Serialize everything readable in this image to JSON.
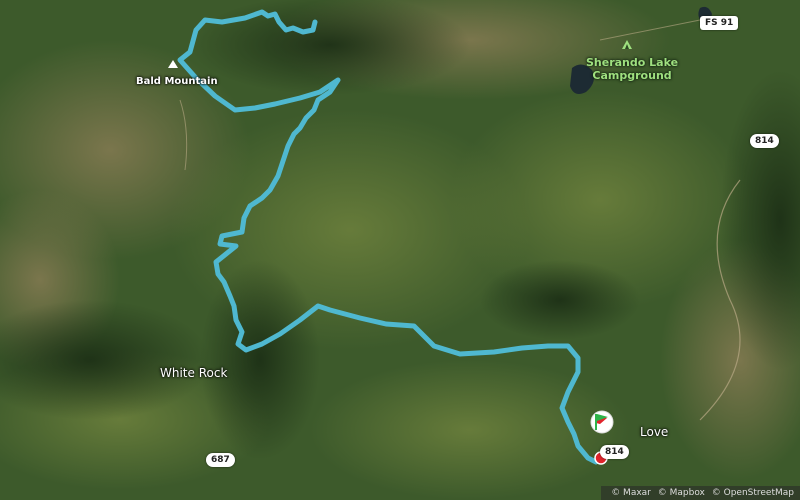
{
  "map": {
    "labels": {
      "bald_mountain": "Bald Mountain",
      "sherando_lake_campground": "Sherando Lake\nCampground",
      "white_rock": "White Rock",
      "love": "Love"
    },
    "road_shields": {
      "fs91": "FS 91",
      "r814_top": "814",
      "r814_bottom": "814",
      "r687": "687"
    },
    "attribution": {
      "maxar": "© Maxar",
      "mapbox": "© Mapbox",
      "osm": "© OpenStreetMap"
    },
    "colors": {
      "route": "#4fb8d0",
      "start_flag_green": "#2fb34a",
      "end_marker_red": "#e0242c",
      "forest": "#3f5f2d"
    },
    "icons": {
      "peak": "peak-triangle-icon",
      "campground": "campground-tent-icon",
      "start": "start-flag-icon",
      "end": "end-pin-icon"
    }
  }
}
